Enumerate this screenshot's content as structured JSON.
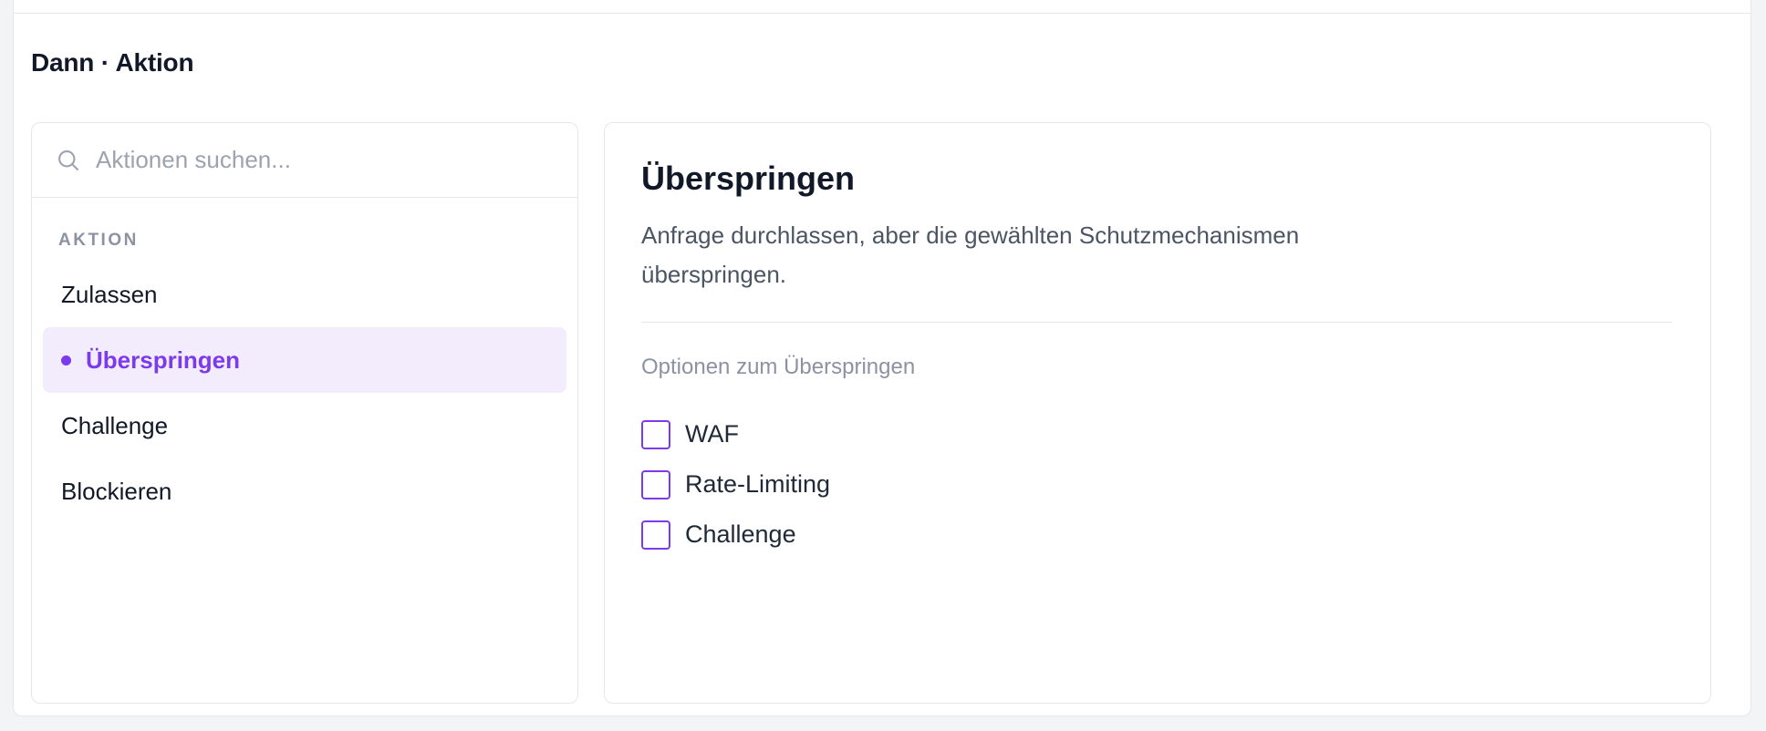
{
  "section": {
    "title": "Dann · Aktion"
  },
  "search": {
    "placeholder": "Aktionen suchen..."
  },
  "actions": {
    "group_label": "AKTION",
    "items": [
      {
        "label": "Zulassen",
        "selected": false
      },
      {
        "label": "Überspringen",
        "selected": true
      },
      {
        "label": "Challenge",
        "selected": false
      },
      {
        "label": "Blockieren",
        "selected": false
      }
    ]
  },
  "detail": {
    "title": "Überspringen",
    "description": "Anfrage durchlassen, aber die gewählten Schutzmechanismen überspringen.",
    "options_label": "Optionen zum Überspringen",
    "options": [
      {
        "label": "WAF",
        "checked": false
      },
      {
        "label": "Rate-Limiting",
        "checked": false
      },
      {
        "label": "Challenge",
        "checked": false
      }
    ]
  },
  "colors": {
    "accent": "#7c3aed",
    "selected_bg": "#f3ecfc",
    "border": "#e5e7eb",
    "muted_text": "#8b92a1"
  },
  "icons": {
    "search": "search-icon"
  }
}
